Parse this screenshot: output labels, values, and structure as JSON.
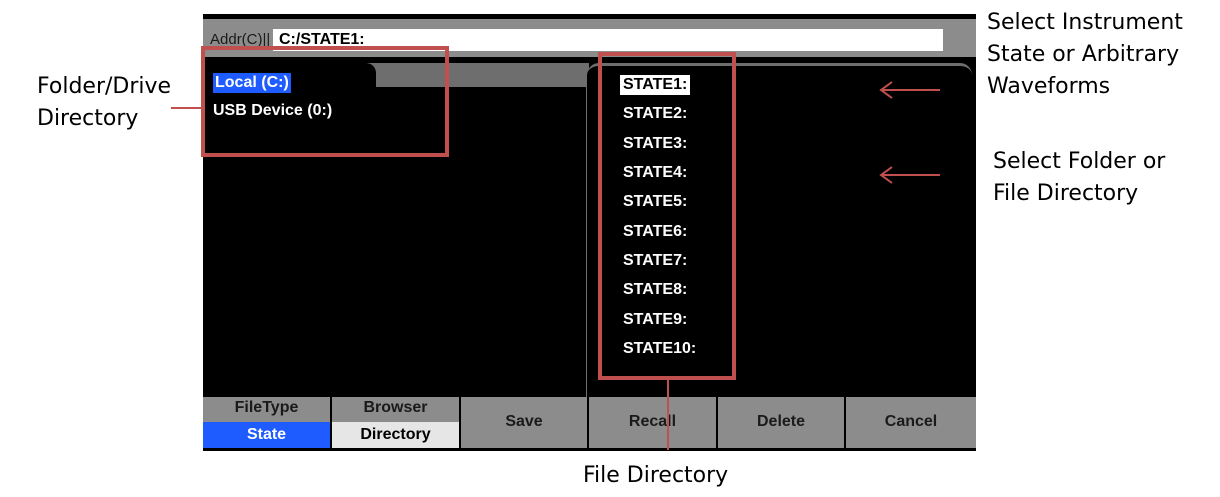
{
  "annotations": {
    "folder_drive_line1": "Folder/Drive",
    "folder_drive_line2": "Directory",
    "select_state_line1": "Select Instrument",
    "select_state_line2": "State or Arbitrary",
    "select_state_line3": "Waveforms",
    "select_folder_line1": "Select Folder or",
    "select_folder_line2": "File Directory",
    "file_directory": "File Directory"
  },
  "address_bar": {
    "label": "Addr(C)||",
    "value": "C:/STATE1:"
  },
  "drives": [
    {
      "label": "Local (C:)",
      "selected": true
    },
    {
      "label": "USB Device (0:)",
      "selected": false
    }
  ],
  "files": [
    {
      "label": "STATE1:",
      "selected": true
    },
    {
      "label": "STATE2:"
    },
    {
      "label": "STATE3:"
    },
    {
      "label": "STATE4:"
    },
    {
      "label": "STATE5:"
    },
    {
      "label": "STATE6:"
    },
    {
      "label": "STATE7:"
    },
    {
      "label": "STATE8:"
    },
    {
      "label": "STATE9:"
    },
    {
      "label": "STATE10:"
    }
  ],
  "softkeys": {
    "filetype_label": "FileType",
    "filetype_value": "State",
    "browser_label": "Browser",
    "browser_value": "Directory",
    "save": "Save",
    "recall": "Recall",
    "delete": "Delete",
    "cancel": "Cancel"
  },
  "colors": {
    "highlight_blue": "#1f5cff",
    "annotation_red": "#c0504d",
    "softkey_gray": "#8c8c8c"
  }
}
